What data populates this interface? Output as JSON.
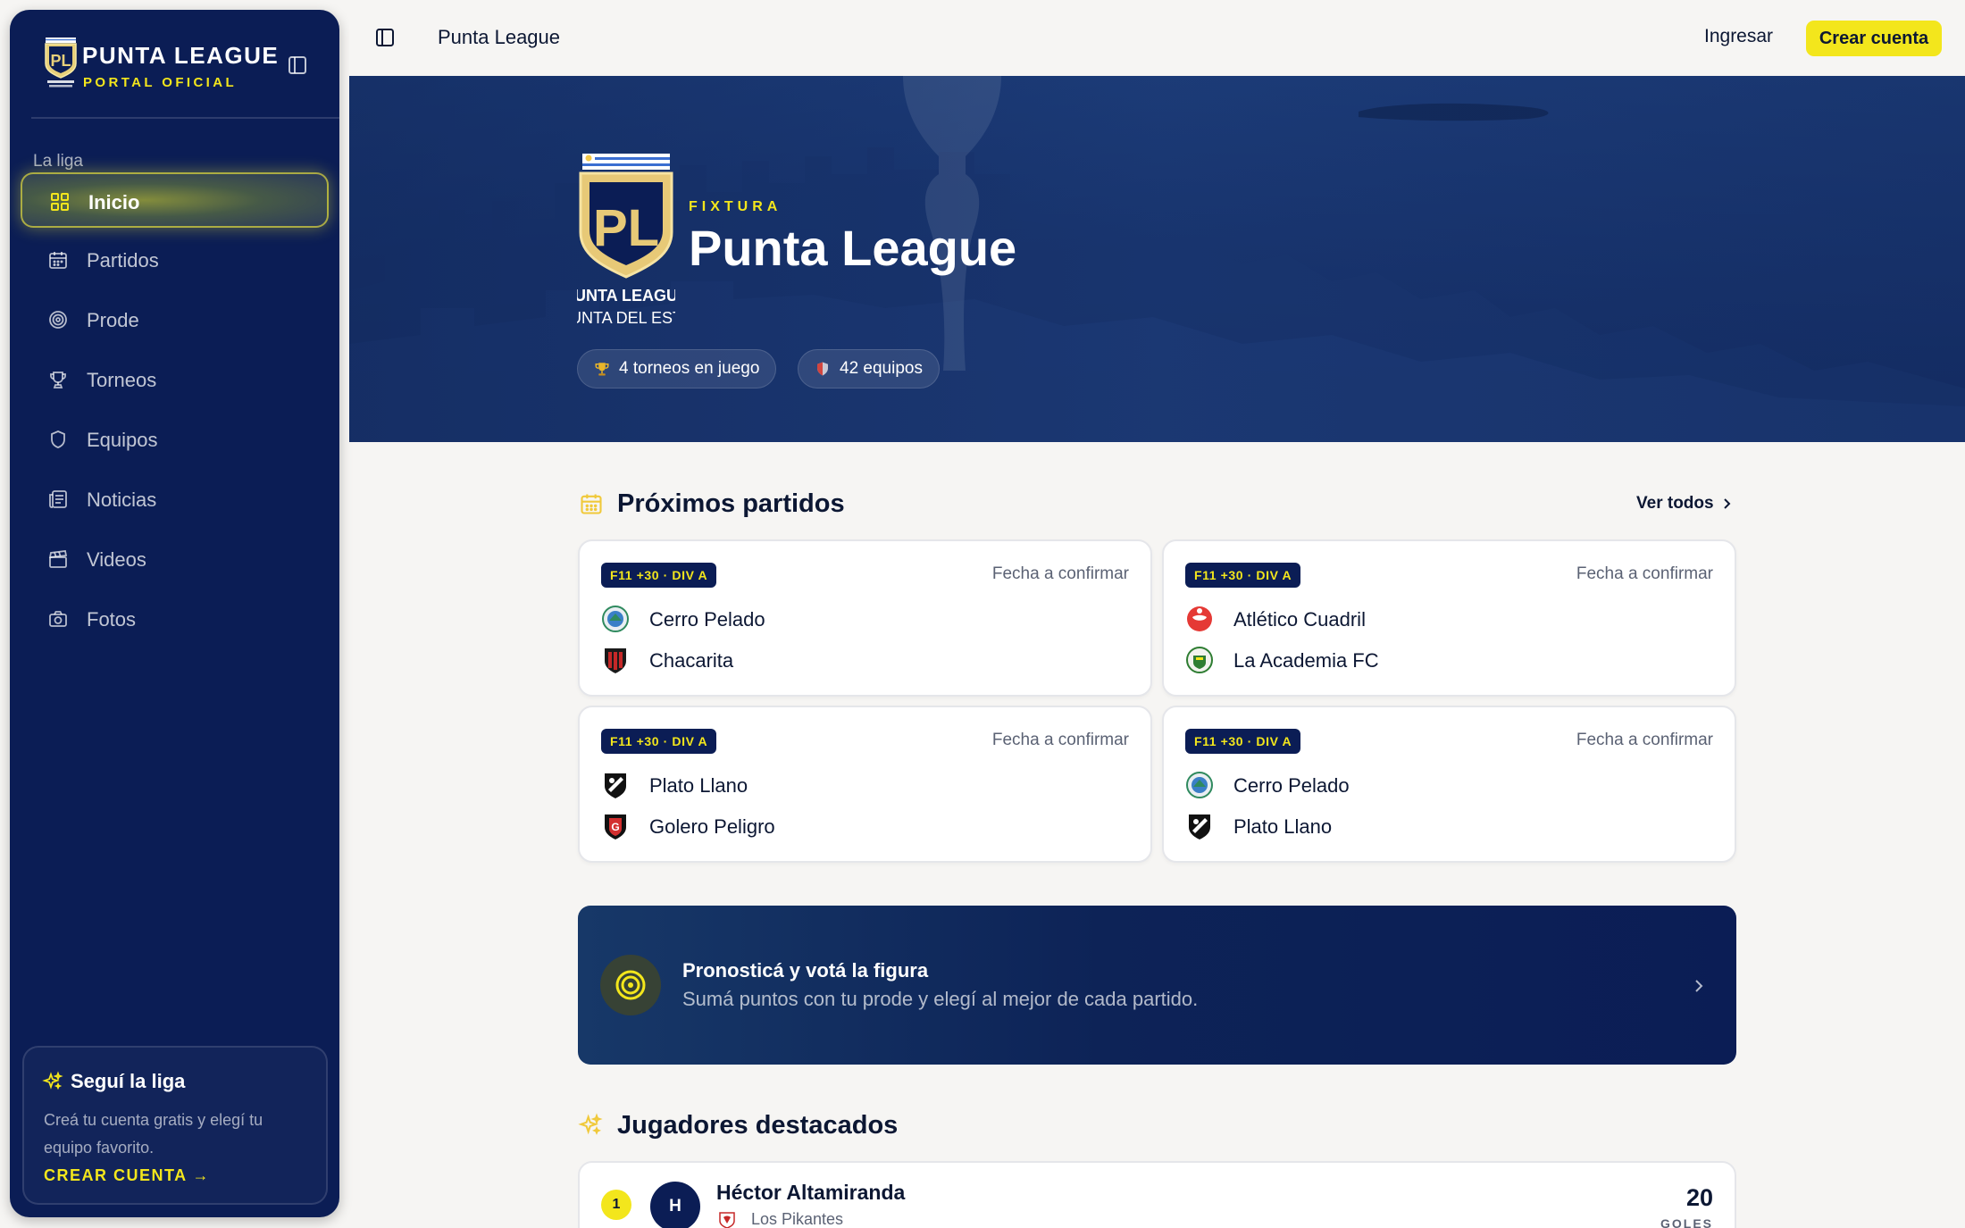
{
  "sidebar": {
    "title": "PUNTA LEAGUE",
    "subtitle": "PORTAL OFICIAL",
    "logo_text": "PUNTA LEAGUE",
    "section_label": "La liga",
    "items": [
      {
        "label": "Inicio",
        "icon": "grid-icon",
        "active": true
      },
      {
        "label": "Partidos",
        "icon": "calendar-icon"
      },
      {
        "label": "Prode",
        "icon": "target-icon"
      },
      {
        "label": "Torneos",
        "icon": "trophy-icon"
      },
      {
        "label": "Equipos",
        "icon": "shield-icon"
      },
      {
        "label": "Noticias",
        "icon": "newspaper-icon"
      },
      {
        "label": "Videos",
        "icon": "clapperboard-icon"
      },
      {
        "label": "Fotos",
        "icon": "camera-icon"
      }
    ],
    "card": {
      "title": "Seguí la liga",
      "text": "Creá tu cuenta gratis y elegí tu equipo favorito.",
      "cta": "CREAR CUENTA →"
    }
  },
  "topbar": {
    "title": "Punta League",
    "login": "Ingresar",
    "signup": "Crear cuenta"
  },
  "hero": {
    "kicker": "FIXTURA",
    "title": "Punta League",
    "logo_lines": [
      "PUNTA LEAGUE",
      "PUNTA DEL ESTE"
    ],
    "chips": [
      {
        "icon": "trophy-icon",
        "text": "4 torneos en juego"
      },
      {
        "icon": "shield-icon",
        "text": "42 equipos"
      }
    ]
  },
  "upcoming": {
    "title": "Próximos partidos",
    "see_all": "Ver todos",
    "matches": [
      {
        "badge": "F11 +30 · DIV A",
        "date": "Fecha a confirmar",
        "home": "Cerro Pelado",
        "away": "Chacarita"
      },
      {
        "badge": "F11 +30 · DIV A",
        "date": "Fecha a confirmar",
        "home": "Atlético Cuadril",
        "away": "La Academia FC"
      },
      {
        "badge": "F11 +30 · DIV A",
        "date": "Fecha a confirmar",
        "home": "Plato Llano",
        "away": "Golero Peligro"
      },
      {
        "badge": "F11 +30 · DIV A",
        "date": "Fecha a confirmar",
        "home": "Cerro Pelado",
        "away": "Plato Llano"
      }
    ]
  },
  "promo": {
    "title": "Pronosticá y votá la figura",
    "subtitle": "Sumá puntos con tu prode y elegí al mejor de cada partido."
  },
  "featured": {
    "title": "Jugadores destacados",
    "players": [
      {
        "rank": "1",
        "initial": "H",
        "name": "Héctor Altamiranda",
        "team": "Los Pikantes",
        "value": "20",
        "stat_label": "GOLES"
      }
    ]
  },
  "colors": {
    "navy": "#0b1d55",
    "accent_yellow": "#f3e61c",
    "background": "#f6f5f3"
  }
}
